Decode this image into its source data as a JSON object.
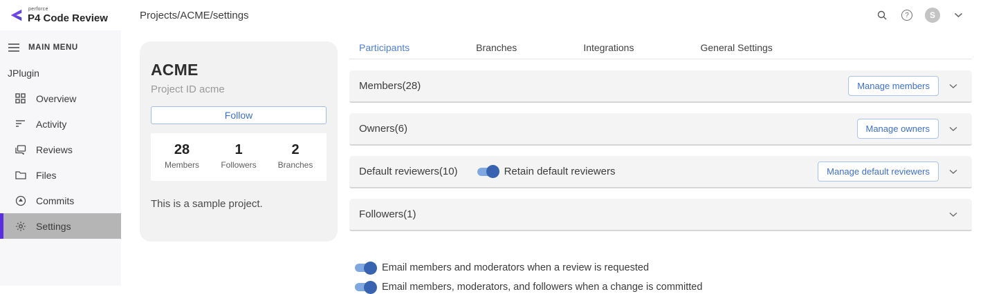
{
  "header": {
    "logo_small": "perforce",
    "logo_text": "P4 Code Review",
    "title": "Projects/ACME/settings",
    "avatar_letter": "S",
    "help_glyph": "?"
  },
  "sidebar": {
    "menu_label": "MAIN MENU",
    "plugin_label": "JPlugin",
    "items": [
      {
        "label": "Overview",
        "icon": "grid-icon",
        "active": false
      },
      {
        "label": "Activity",
        "icon": "activity-icon",
        "active": false
      },
      {
        "label": "Reviews",
        "icon": "reviews-icon",
        "active": false
      },
      {
        "label": "Files",
        "icon": "folder-icon",
        "active": false
      },
      {
        "label": "Commits",
        "icon": "commit-icon",
        "active": false
      },
      {
        "label": "Settings",
        "icon": "gear-icon",
        "active": true
      }
    ]
  },
  "project_card": {
    "name": "ACME",
    "id_label": "Project ID acme",
    "follow_button": "Follow",
    "stats": [
      {
        "value": "28",
        "label": "Members"
      },
      {
        "value": "1",
        "label": "Followers"
      },
      {
        "value": "2",
        "label": "Branches"
      }
    ],
    "description": "This is a sample project."
  },
  "tabs": [
    {
      "label": "Participants",
      "active": true
    },
    {
      "label": "Branches",
      "active": false
    },
    {
      "label": "Integrations",
      "active": false
    },
    {
      "label": "General Settings",
      "active": false
    }
  ],
  "sections": [
    {
      "title": "Members(28)",
      "button": "Manage members"
    },
    {
      "title": "Owners(6)",
      "button": "Manage owners"
    },
    {
      "title": "Default reviewers(10)",
      "toggle_label": "Retain default reviewers",
      "toggle_on": true,
      "button": "Manage default reviewers"
    },
    {
      "title": "Followers(1)"
    }
  ],
  "email_toggles": [
    {
      "label": "Email members and moderators when a review is requested",
      "on": true
    },
    {
      "label": "Email members, moderators, and followers when a change is committed",
      "on": true
    }
  ],
  "colors": {
    "accent_blue": "#3d6fc7",
    "button_border": "#a9c4ea",
    "toggle_track": "#7fa7e0",
    "toggle_knob": "#3763b0",
    "brand_purple": "#5b2ee0",
    "active_item_bg": "#b5b5b5",
    "row_bg": "#f4f4f4",
    "card_bg": "#f2f2f2",
    "sidebar_bg": "#f7f7fa"
  }
}
